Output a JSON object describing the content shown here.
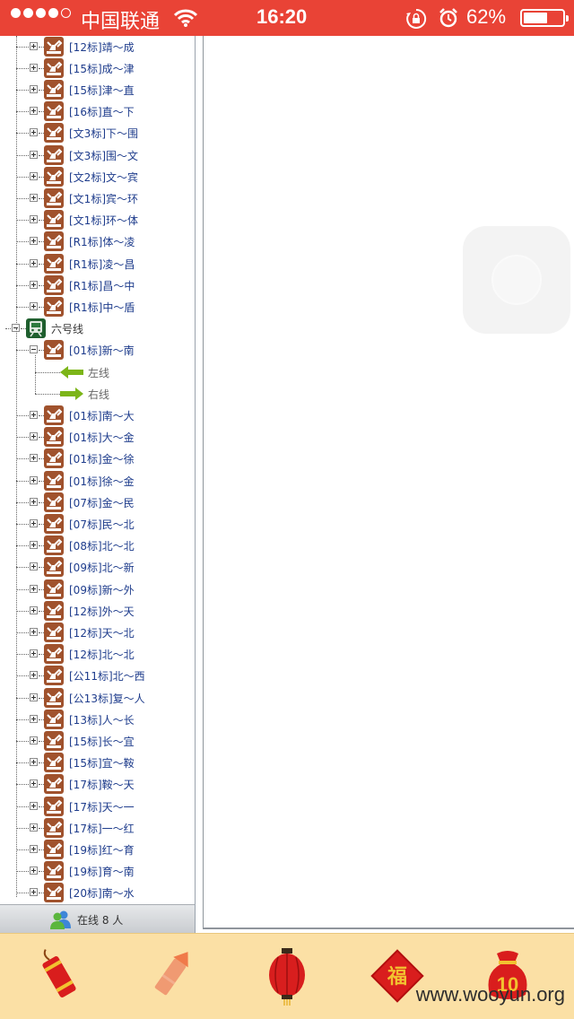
{
  "statusbar": {
    "carrier": "中国联通",
    "time": "16:20",
    "battery_percent": "62%",
    "battery_level": 0.62,
    "signal_bars": 4,
    "icons": [
      "signal-dots-icon",
      "wifi-icon",
      "rotation-lock-icon",
      "alarm-icon",
      "battery-icon"
    ]
  },
  "tree": {
    "group_before": [
      "[12标]靖～成",
      "[15标]成～津",
      "[15标]津～直",
      "[16标]直～下",
      "[文3标]下～围",
      "[文3标]围～文",
      "[文2标]文～宾",
      "[文1标]宾～环",
      "[文1标]环～体",
      "[R1标]体～凌",
      "[R1标]凌～昌",
      "[R1标]昌～中",
      "[R1标]中～盾"
    ],
    "line6": {
      "label": "六号线",
      "expanded_item": "[01标]新～南",
      "directions": [
        "左线",
        "右线"
      ],
      "items": [
        "[01标]南～大",
        "[01标]大～金",
        "[01标]金～徐",
        "[01标]徐～金",
        "[07标]金～民",
        "[07标]民～北",
        "[08标]北～北",
        "[09标]北～新",
        "[09标]新～外",
        "[12标]外～天",
        "[12标]天～北",
        "[12标]北～北",
        "[公11标]北～西",
        "[公13标]复～人",
        "[13标]人～长",
        "[15标]长～宜",
        "[15标]宜～鞍",
        "[17标]鞍～天",
        "[17标]天～一",
        "[17标]一～红",
        "[19标]红～育",
        "[19标]育～南",
        "[20标]南～水"
      ]
    }
  },
  "online": {
    "label": "在线  8 人"
  },
  "bottombar": {
    "items": [
      {
        "name": "firecracker-icon"
      },
      {
        "name": "firework-rocket-icon"
      },
      {
        "name": "red-lantern-icon"
      },
      {
        "name": "fu-diamond-icon",
        "text": "福"
      },
      {
        "name": "lucky-bag-icon",
        "text": "10"
      }
    ]
  },
  "watermark": "www.wooyun.org",
  "colors": {
    "statusbar_bg": "#e94336",
    "bottombar_bg": "#fbe0a5",
    "node_label": "#1e3c8c",
    "node_icon": "#a0522d",
    "arrow_green": "#7cb518"
  }
}
